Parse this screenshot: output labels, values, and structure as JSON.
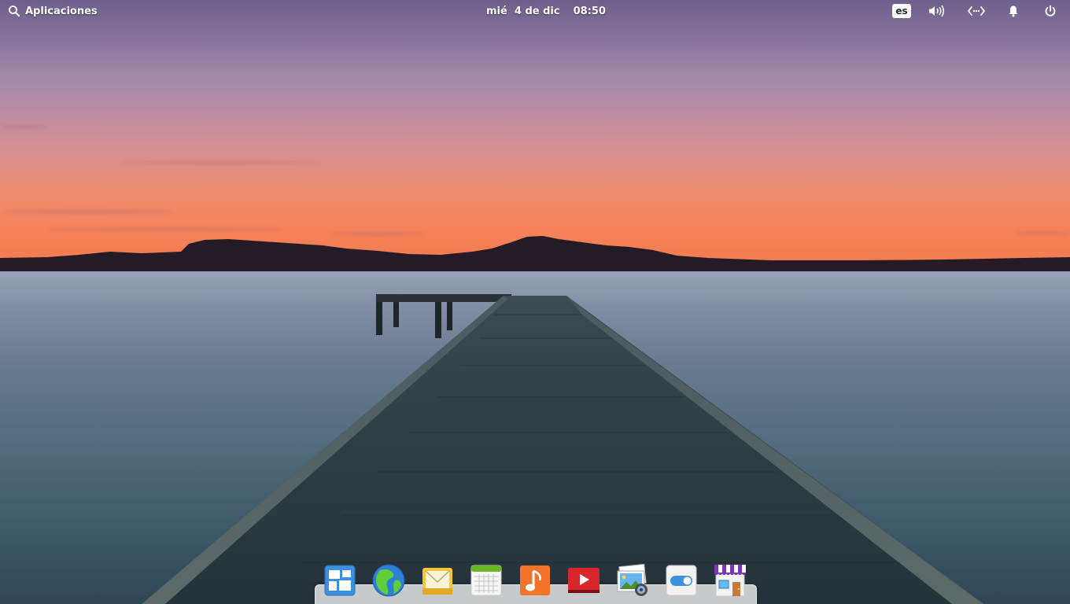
{
  "top_panel": {
    "applications_label": "Aplicaciones",
    "date": "mié  4 de dic",
    "time": "08:50",
    "keyboard_layout": "es",
    "icons": [
      "search-icon",
      "keyboard-layout-badge",
      "volume-icon",
      "network-icon",
      "notifications-icon",
      "power-icon"
    ]
  },
  "dock": {
    "items": [
      {
        "icon": "multitasking-view-icon"
      },
      {
        "icon": "web-browser-icon"
      },
      {
        "icon": "mail-icon"
      },
      {
        "icon": "calendar-icon"
      },
      {
        "icon": "music-icon"
      },
      {
        "icon": "videos-icon"
      },
      {
        "icon": "photos-icon"
      },
      {
        "icon": "system-settings-icon"
      },
      {
        "icon": "appcenter-icon"
      }
    ]
  }
}
